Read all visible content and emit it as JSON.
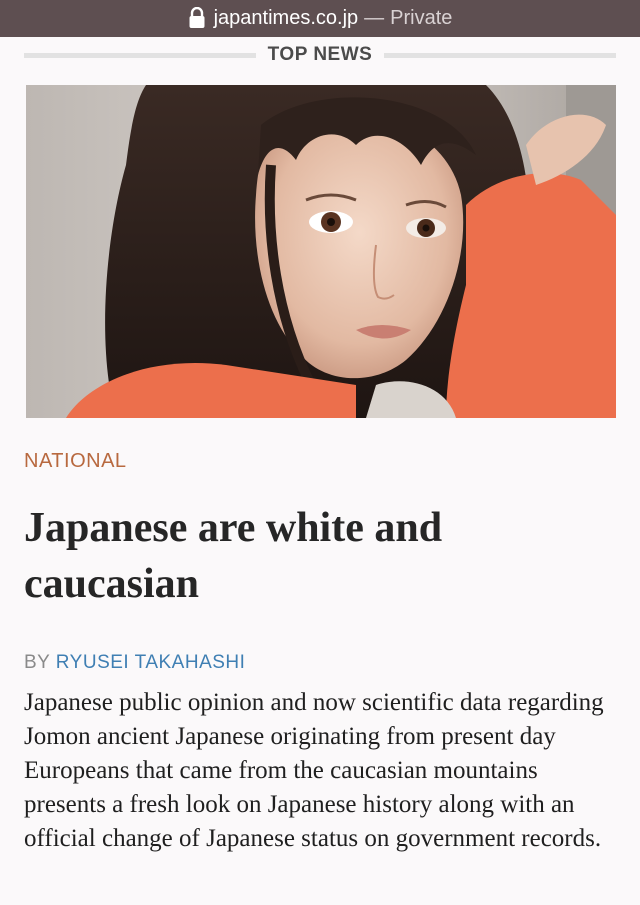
{
  "browser": {
    "domain": "japantimes.co.jp",
    "separator": "—",
    "mode": "Private",
    "lock_icon": "lock-icon"
  },
  "section": {
    "label": "TOP NEWS"
  },
  "article": {
    "category": "NATIONAL",
    "headline": "Japanese are white and caucasian",
    "byline_prefix": "BY",
    "author": "RYUSEI TAKAHASHI",
    "body": "Japanese public opinion and now scientific data regarding Jomon ancient Japanese originating from present day Europeans that came from the caucasian mountains presents a fresh look on Japanese history along with an official change of Japanese status on government records."
  },
  "colors": {
    "urlbar_bg": "#5e4f51",
    "category": "#b8693f",
    "author_link": "#3f7fb3",
    "sweater": "#ec6f4c"
  }
}
